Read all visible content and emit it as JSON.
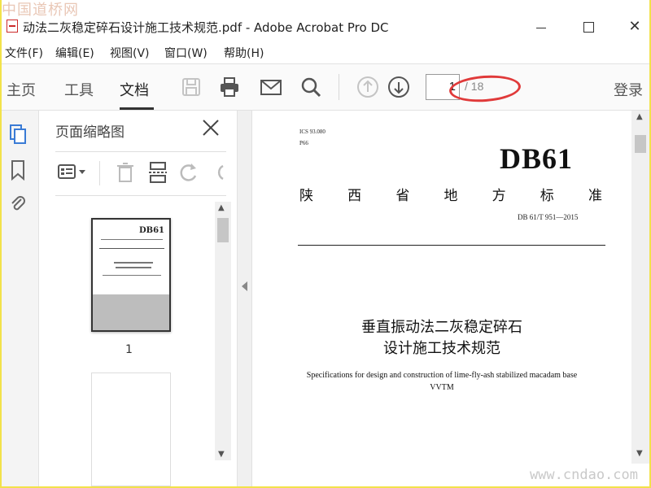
{
  "watermarks": {
    "top": "中国道桥网",
    "bottom": "www.cndao.com"
  },
  "window": {
    "title": "动法二灰稳定碎石设计施工技术规范.pdf - Adobe Acrobat Pro DC",
    "minimize": "",
    "maximize": "",
    "close": "✕"
  },
  "menu": [
    "文件(F)",
    "编辑(E)",
    "视图(V)",
    "窗口(W)",
    "帮助(H)"
  ],
  "tabs": [
    "主页",
    "工具",
    "文档"
  ],
  "toolbar": {
    "page_current": "1",
    "page_total": "/ 18",
    "login": "登录"
  },
  "panel": {
    "title": "页面缩略图",
    "thumb_label": "1",
    "thumb_db": "DB61"
  },
  "document": {
    "ics": "ICS 93.080",
    "p66": "P66",
    "db": "DB61",
    "province": [
      "陕",
      "西",
      "省",
      "地",
      "方",
      "标",
      "准"
    ],
    "code": "DB 61/T  951—2015",
    "title_line1": "垂直振动法二灰稳定碎石",
    "title_line2": "设计施工技术规范",
    "english_line1": "Specifications for design and construction of   lime-fly-ash stabilized macadam base",
    "english_line2": "VVTM"
  },
  "colors": {
    "frame": "#f2e24a",
    "annotation": "#e03a3a",
    "accent": "#3a7bd5"
  }
}
